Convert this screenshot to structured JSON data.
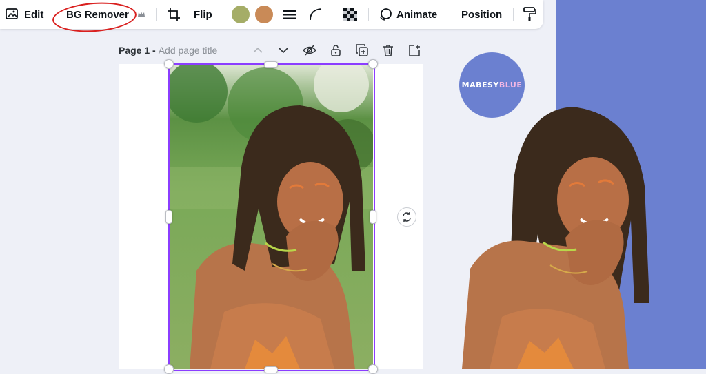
{
  "toolbar": {
    "edit_label": "Edit",
    "bg_remover_label": "BG Remover",
    "flip_label": "Flip",
    "animate_label": "Animate",
    "position_label": "Position",
    "swatches": [
      "#a5ad67",
      "#c98a57"
    ]
  },
  "page_header": {
    "page_label": "Page 1 -",
    "title_placeholder": "Add page title"
  },
  "logo": {
    "part1": "MABESY",
    "part2": "BLUE"
  },
  "colors": {
    "selection": "#8b3dff",
    "annotation_circle": "#d9201f",
    "side_panel": "#6b80d0"
  }
}
